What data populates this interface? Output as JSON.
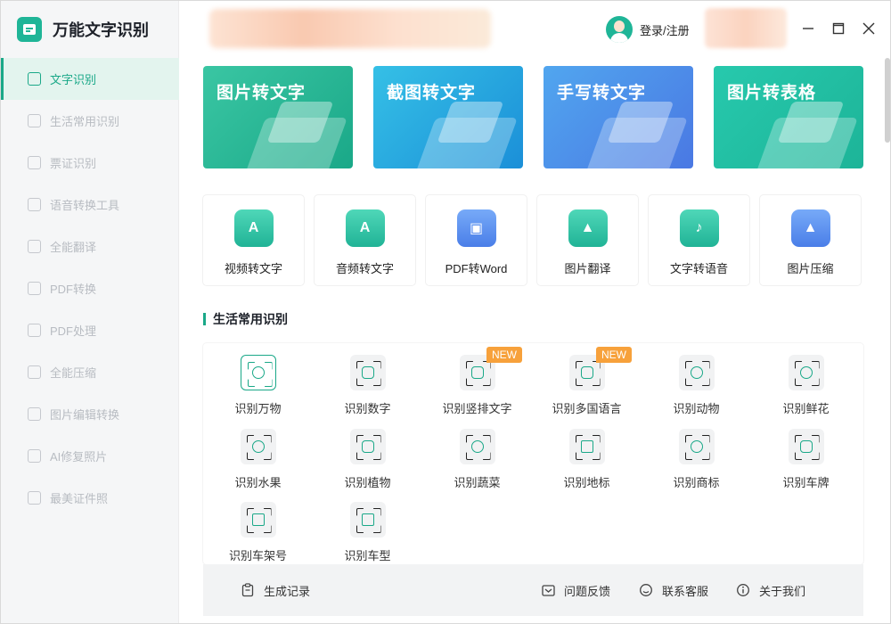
{
  "app": {
    "title": "万能文字识别"
  },
  "sidebar": {
    "items": [
      {
        "label": "文字识别",
        "active": true
      },
      {
        "label": "生活常用识别"
      },
      {
        "label": "票证识别"
      },
      {
        "label": "语音转换工具"
      },
      {
        "label": "全能翻译"
      },
      {
        "label": "PDF转换"
      },
      {
        "label": "PDF处理"
      },
      {
        "label": "全能压缩"
      },
      {
        "label": "图片编辑转换"
      },
      {
        "label": "AI修复照片"
      },
      {
        "label": "最美证件照"
      }
    ]
  },
  "header": {
    "login_label": "登录/注册"
  },
  "banners": [
    {
      "label": "图片转文字",
      "icon": "image-to-text-illustration"
    },
    {
      "label": "截图转文字",
      "icon": "screenshot-to-text-illustration"
    },
    {
      "label": "手写转文字",
      "icon": "handwriting-to-text-illustration"
    },
    {
      "label": "图片转表格",
      "icon": "image-to-table-illustration"
    }
  ],
  "tools": [
    {
      "label": "视频转文字",
      "icon": "video-text-icon",
      "color": "green"
    },
    {
      "label": "音频转文字",
      "icon": "audio-text-icon",
      "color": "green"
    },
    {
      "label": "PDF转Word",
      "icon": "pdf-word-icon",
      "color": "blue"
    },
    {
      "label": "图片翻译",
      "icon": "image-translate-icon",
      "color": "green"
    },
    {
      "label": "文字转语音",
      "icon": "text-to-speech-icon",
      "color": "green"
    },
    {
      "label": "图片压缩",
      "icon": "image-compress-icon",
      "color": "blue"
    }
  ],
  "section": {
    "title": "生活常用识别"
  },
  "life_items": [
    {
      "label": "识别万物",
      "icon": "eye-scan-icon",
      "selected": true
    },
    {
      "label": "识别数字",
      "icon": "number-scan-icon"
    },
    {
      "label": "识别竖排文字",
      "icon": "vertical-text-icon",
      "badge": "NEW"
    },
    {
      "label": "识别多国语言",
      "icon": "multi-language-icon",
      "badge": "NEW"
    },
    {
      "label": "识别动物",
      "icon": "animal-icon"
    },
    {
      "label": "识别鲜花",
      "icon": "flower-icon"
    },
    {
      "label": "识别水果",
      "icon": "fruit-icon"
    },
    {
      "label": "识别植物",
      "icon": "plant-icon"
    },
    {
      "label": "识别蔬菜",
      "icon": "vegetable-icon"
    },
    {
      "label": "识别地标",
      "icon": "landmark-icon"
    },
    {
      "label": "识别商标",
      "icon": "trademark-icon"
    },
    {
      "label": "识别车牌",
      "icon": "license-plate-icon"
    },
    {
      "label": "识别车架号",
      "icon": "vin-icon"
    },
    {
      "label": "识别车型",
      "icon": "car-model-icon"
    }
  ],
  "footer": {
    "records_label": "生成记录",
    "feedback_label": "问题反馈",
    "service_label": "联系客服",
    "about_label": "关于我们"
  },
  "colors": {
    "accent": "#1aa888",
    "badge": "#f7a13b",
    "sidebar_bg": "#f5f6f7"
  }
}
